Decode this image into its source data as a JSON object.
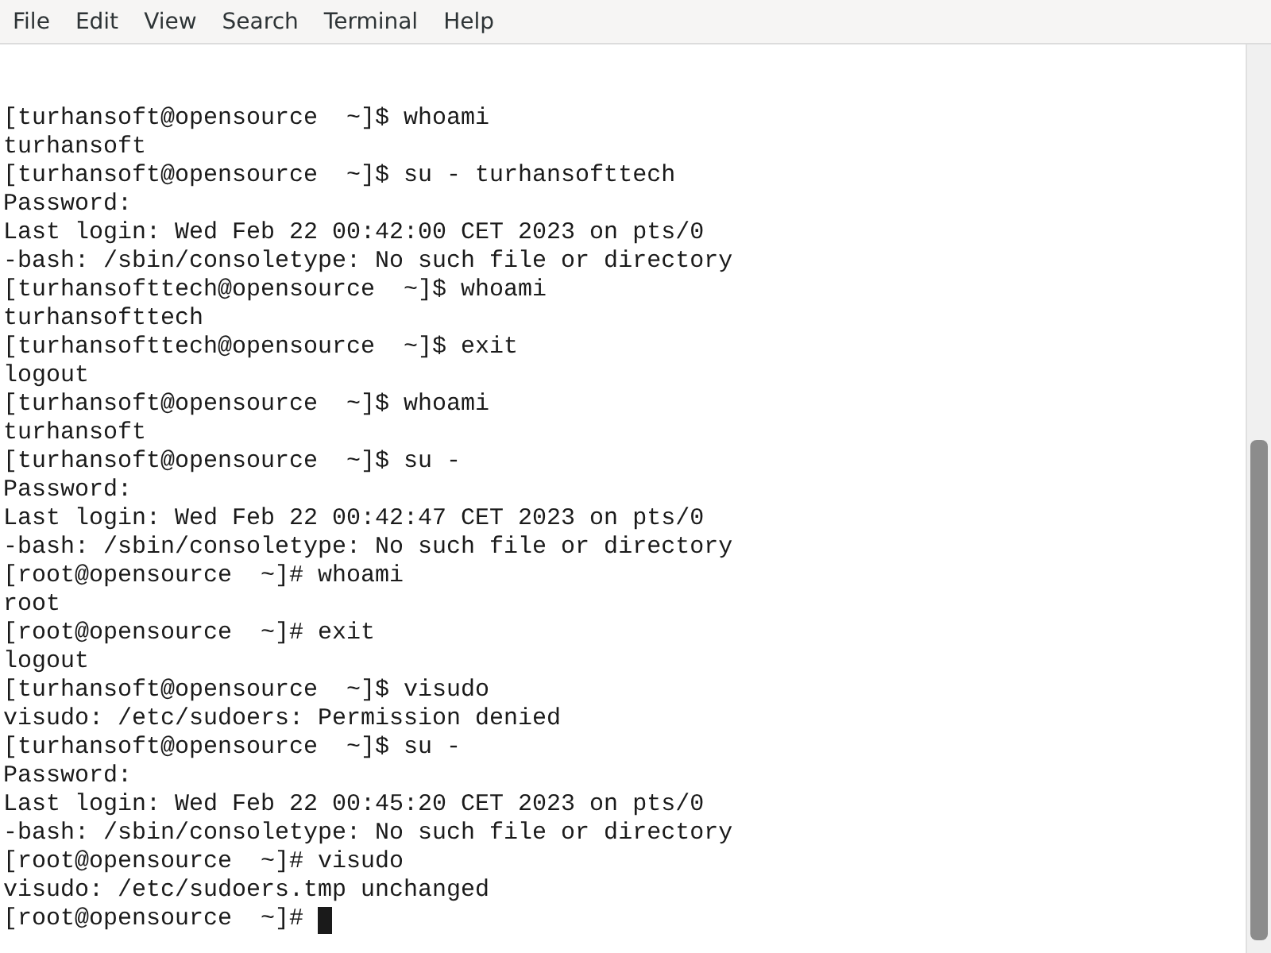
{
  "menu_bar": {
    "items": [
      "File",
      "Edit",
      "View",
      "Search",
      "Terminal",
      "Help"
    ]
  },
  "terminal": {
    "lines": [
      "[turhansoft@opensource  ~]$ whoami",
      "turhansoft",
      "[turhansoft@opensource  ~]$ su - turhansofttech",
      "Password:",
      "Last login: Wed Feb 22 00:42:00 CET 2023 on pts/0",
      "-bash: /sbin/consoletype: No such file or directory",
      "[turhansofttech@opensource  ~]$ whoami",
      "turhansofttech",
      "[turhansofttech@opensource  ~]$ exit",
      "logout",
      "[turhansoft@opensource  ~]$ whoami",
      "turhansoft",
      "[turhansoft@opensource  ~]$ su -",
      "Password:",
      "Last login: Wed Feb 22 00:42:47 CET 2023 on pts/0",
      "-bash: /sbin/consoletype: No such file or directory",
      "[root@opensource  ~]# whoami",
      "root",
      "[root@opensource  ~]# exit",
      "logout",
      "[turhansoft@opensource  ~]$ visudo",
      "visudo: /etc/sudoers: Permission denied",
      "[turhansoft@opensource  ~]$ su -",
      "Password:",
      "Last login: Wed Feb 22 00:45:20 CET 2023 on pts/0",
      "-bash: /sbin/consoletype: No such file or directory",
      "[root@opensource  ~]# visudo",
      "visudo: /etc/sudoers.tmp unchanged"
    ],
    "prompt": "[root@opensource  ~]# "
  }
}
